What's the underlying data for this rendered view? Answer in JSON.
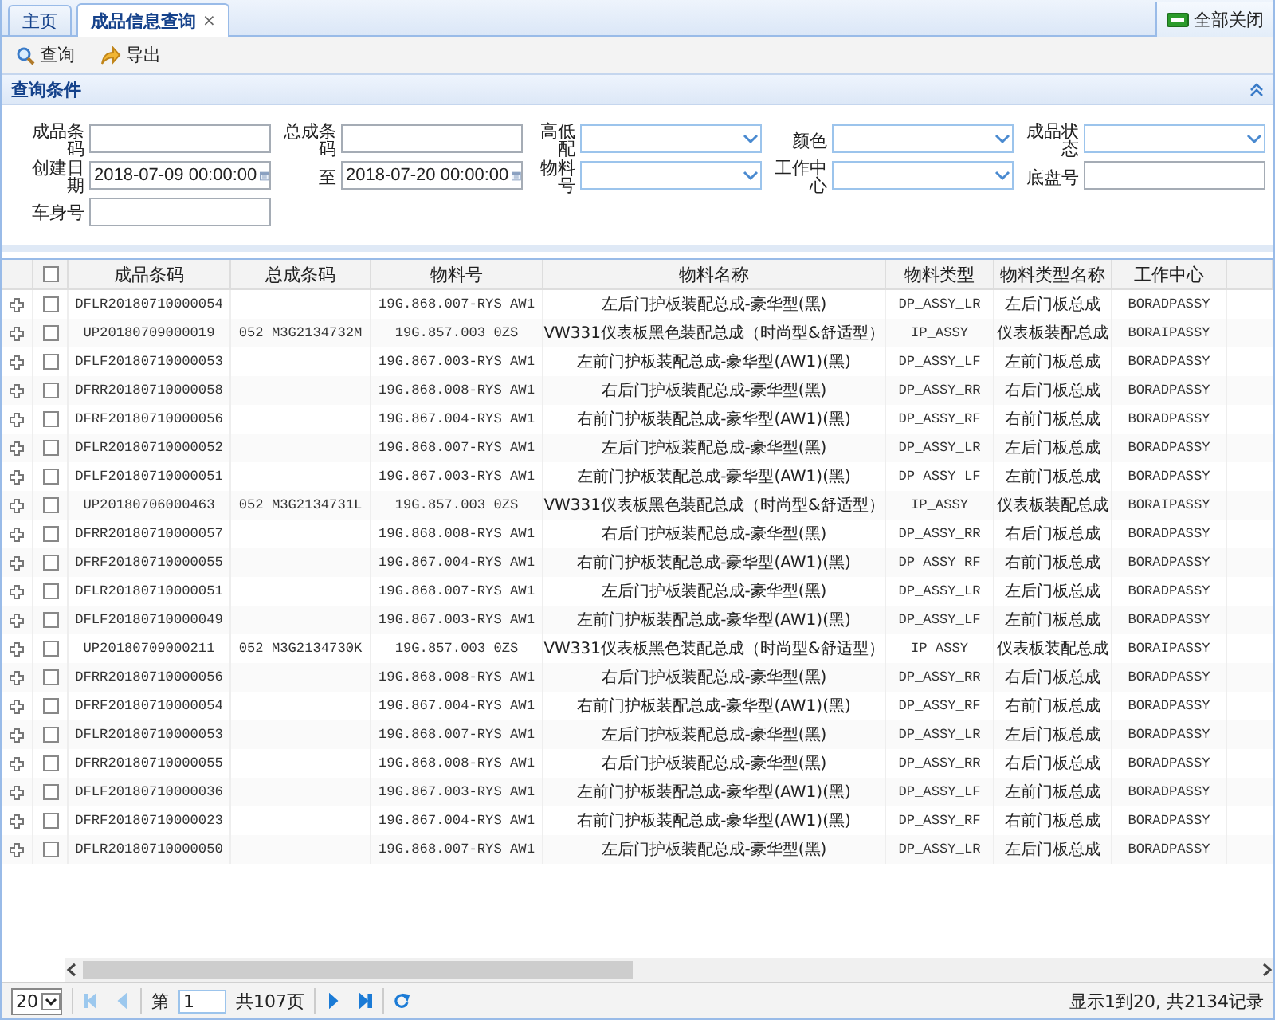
{
  "tabs": [
    {
      "label": "主页",
      "selected": false
    },
    {
      "label": "成品信息查询",
      "selected": true,
      "close": "×"
    }
  ],
  "close_all_button": "全部关闭",
  "toolbar": [
    {
      "kind": "search",
      "label": "查询"
    },
    {
      "kind": "export",
      "label": "导出"
    }
  ],
  "query_panel": {
    "title": "查询条件",
    "fields": [
      {
        "label": "成品条码",
        "kind": "text"
      },
      {
        "label": "总成条码",
        "kind": "text"
      },
      {
        "label": "高低配",
        "kind": "select"
      },
      {
        "label": "颜色",
        "kind": "select"
      },
      {
        "label": "成品状态",
        "kind": "select"
      },
      {
        "label": "创建日期",
        "kind": "date",
        "value": "2018-07-09 00:00:00"
      },
      {
        "label": "至",
        "kind": "date",
        "value": "2018-07-20 00:00:00"
      },
      {
        "label": "物料号",
        "kind": "select"
      },
      {
        "label": "工作中心",
        "kind": "select"
      },
      {
        "label": "底盘号",
        "kind": "text"
      },
      {
        "label": "车身号",
        "kind": "text"
      }
    ]
  },
  "table": {
    "header_checked": false,
    "columns": [
      "成品条码",
      "总成条码",
      "物料号",
      "物料名称",
      "物料类型",
      "物料类型名称",
      "工作中心"
    ],
    "rows": [
      {
        "checked": false,
        "cells": [
          "DFLR20180710000054",
          null,
          "19G.868.007-RYS AW1",
          "左后门护板装配总成-豪华型(黑)",
          "DP_ASSY_LR",
          "左后门板总成",
          "BORADPASSY"
        ]
      },
      {
        "checked": false,
        "cells": [
          "UP20180709000019",
          "052 M3G2134732M",
          "19G.857.003 0ZS",
          "VW331仪表板黑色装配总成（时尚型&舒适型）",
          "IP_ASSY",
          "仪表板装配总成",
          "BORAIPASSY"
        ]
      },
      {
        "checked": false,
        "cells": [
          "DFLF20180710000053",
          null,
          "19G.867.003-RYS AW1",
          "左前门护板装配总成-豪华型(AW1)(黑)",
          "DP_ASSY_LF",
          "左前门板总成",
          "BORADPASSY"
        ]
      },
      {
        "checked": false,
        "cells": [
          "DFRR20180710000058",
          null,
          "19G.868.008-RYS AW1",
          "右后门护板装配总成-豪华型(黑)",
          "DP_ASSY_RR",
          "右后门板总成",
          "BORADPASSY"
        ]
      },
      {
        "checked": false,
        "cells": [
          "DFRF20180710000056",
          null,
          "19G.867.004-RYS AW1",
          "右前门护板装配总成-豪华型(AW1)(黑)",
          "DP_ASSY_RF",
          "右前门板总成",
          "BORADPASSY"
        ]
      },
      {
        "checked": false,
        "cells": [
          "DFLR20180710000052",
          null,
          "19G.868.007-RYS AW1",
          "左后门护板装配总成-豪华型(黑)",
          "DP_ASSY_LR",
          "左后门板总成",
          "BORADPASSY"
        ]
      },
      {
        "checked": false,
        "cells": [
          "DFLF20180710000051",
          null,
          "19G.867.003-RYS AW1",
          "左前门护板装配总成-豪华型(AW1)(黑)",
          "DP_ASSY_LF",
          "左前门板总成",
          "BORADPASSY"
        ]
      },
      {
        "checked": false,
        "cells": [
          "UP20180706000463",
          "052 M3G2134731L",
          "19G.857.003 0ZS",
          "VW331仪表板黑色装配总成（时尚型&舒适型）",
          "IP_ASSY",
          "仪表板装配总成",
          "BORAIPASSY"
        ]
      },
      {
        "checked": false,
        "cells": [
          "DFRR20180710000057",
          null,
          "19G.868.008-RYS AW1",
          "右后门护板装配总成-豪华型(黑)",
          "DP_ASSY_RR",
          "右后门板总成",
          "BORADPASSY"
        ]
      },
      {
        "checked": false,
        "cells": [
          "DFRF20180710000055",
          null,
          "19G.867.004-RYS AW1",
          "右前门护板装配总成-豪华型(AW1)(黑)",
          "DP_ASSY_RF",
          "右前门板总成",
          "BORADPASSY"
        ]
      },
      {
        "checked": false,
        "cells": [
          "DFLR20180710000051",
          null,
          "19G.868.007-RYS AW1",
          "左后门护板装配总成-豪华型(黑)",
          "DP_ASSY_LR",
          "左后门板总成",
          "BORADPASSY"
        ]
      },
      {
        "checked": false,
        "cells": [
          "DFLF20180710000049",
          null,
          "19G.867.003-RYS AW1",
          "左前门护板装配总成-豪华型(AW1)(黑)",
          "DP_ASSY_LF",
          "左前门板总成",
          "BORADPASSY"
        ]
      },
      {
        "checked": false,
        "cells": [
          "UP20180709000211",
          "052 M3G2134730K",
          "19G.857.003 0ZS",
          "VW331仪表板黑色装配总成（时尚型&舒适型）",
          "IP_ASSY",
          "仪表板装配总成",
          "BORAIPASSY"
        ]
      },
      {
        "checked": false,
        "cells": [
          "DFRR20180710000056",
          null,
          "19G.868.008-RYS AW1",
          "右后门护板装配总成-豪华型(黑)",
          "DP_ASSY_RR",
          "右后门板总成",
          "BORADPASSY"
        ]
      },
      {
        "checked": false,
        "cells": [
          "DFRF20180710000054",
          null,
          "19G.867.004-RYS AW1",
          "右前门护板装配总成-豪华型(AW1)(黑)",
          "DP_ASSY_RF",
          "右前门板总成",
          "BORADPASSY"
        ]
      },
      {
        "checked": false,
        "cells": [
          "DFLR20180710000053",
          null,
          "19G.868.007-RYS AW1",
          "左后门护板装配总成-豪华型(黑)",
          "DP_ASSY_LR",
          "左后门板总成",
          "BORADPASSY"
        ]
      },
      {
        "checked": false,
        "cells": [
          "DFRR20180710000055",
          null,
          "19G.868.008-RYS AW1",
          "右后门护板装配总成-豪华型(黑)",
          "DP_ASSY_RR",
          "右后门板总成",
          "BORADPASSY"
        ]
      },
      {
        "checked": false,
        "cells": [
          "DFLF20180710000036",
          null,
          "19G.867.003-RYS AW1",
          "左前门护板装配总成-豪华型(AW1)(黑)",
          "DP_ASSY_LF",
          "左前门板总成",
          "BORADPASSY"
        ]
      },
      {
        "checked": false,
        "cells": [
          "DFRF20180710000023",
          null,
          "19G.867.004-RYS AW1",
          "右前门护板装配总成-豪华型(AW1)(黑)",
          "DP_ASSY_RF",
          "右前门板总成",
          "BORADPASSY"
        ]
      },
      {
        "checked": false,
        "cells": [
          "DFLR20180710000050",
          null,
          "19G.868.007-RYS AW1",
          "左后门护板装配总成-豪华型(黑)",
          "DP_ASSY_LR",
          "左后门板总成",
          "BORADPASSY"
        ]
      }
    ]
  },
  "pager": {
    "page_size": "20",
    "buttons": [
      {
        "kind": "first",
        "disabled": true
      },
      {
        "kind": "prev",
        "disabled": true
      },
      {
        "kind": "next",
        "disabled": false
      },
      {
        "kind": "last",
        "disabled": false
      },
      {
        "kind": "refresh",
        "disabled": false
      }
    ],
    "page_prefix": "第",
    "page": "1",
    "total_pages": "共107页",
    "summary": "显示1到20, 共2134记录"
  }
}
